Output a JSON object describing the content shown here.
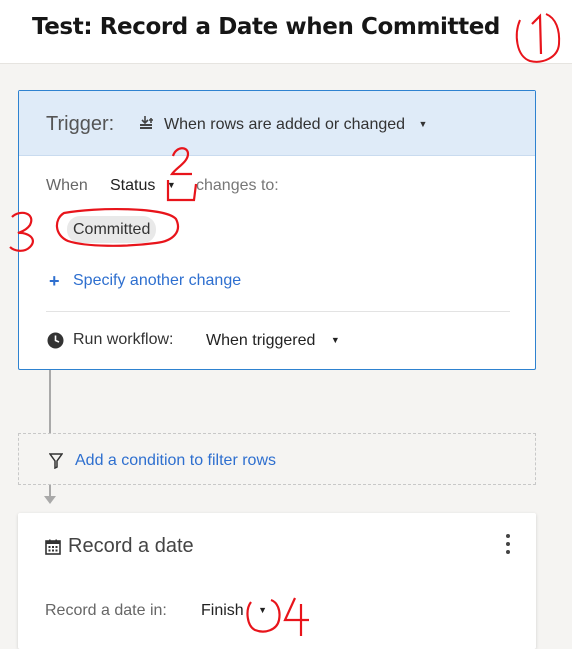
{
  "header": {
    "title": "Test: Record a Date when Committed"
  },
  "annotations": [
    "1",
    "2",
    "3",
    "4"
  ],
  "trigger": {
    "label": "Trigger:",
    "event": "When rows are added or changed",
    "event_icon": "rows-changed-icon",
    "when_label": "When",
    "field": "Status",
    "changes_to": "changes to:",
    "value_chip": "Committed",
    "specify_another": "Specify another change",
    "run_label": "Run workflow:",
    "run_value": "When triggered"
  },
  "condition": {
    "label": "Add a condition to filter rows"
  },
  "action": {
    "title": "Record a date",
    "record_in_label": "Record a date in:",
    "record_in_value": "Finish"
  },
  "colors": {
    "accent_blue": "#2e6fcf",
    "trigger_header_bg": "#dfebf8",
    "annotation_red": "#e8141b"
  }
}
